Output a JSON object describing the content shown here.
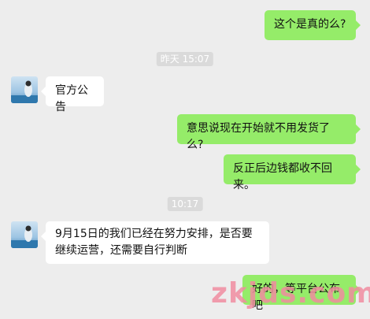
{
  "messages": [
    {
      "side": "out",
      "text": "这个是真的么?"
    },
    {
      "type": "time",
      "text": "昨天 15:07"
    },
    {
      "side": "in",
      "text": "官方公告"
    },
    {
      "side": "out",
      "text": "意思说现在开始就不用发货了么?"
    },
    {
      "side": "out",
      "text": "反正后边钱都收不回来。"
    },
    {
      "type": "time",
      "text": "10:17"
    },
    {
      "side": "in",
      "text": "9月15日的我们已经在努力安排，是否要继续运营，还需要自行判断"
    },
    {
      "side": "out",
      "text": "好的，等平台公布吧"
    }
  ],
  "watermark": "zkjds.com",
  "colors": {
    "background": "#ededed",
    "outgoing_bubble": "#95ec69",
    "incoming_bubble": "#ffffff",
    "timestamp_bg": "#dadada"
  },
  "icons": {
    "contact_avatar": "avatar-photo"
  }
}
